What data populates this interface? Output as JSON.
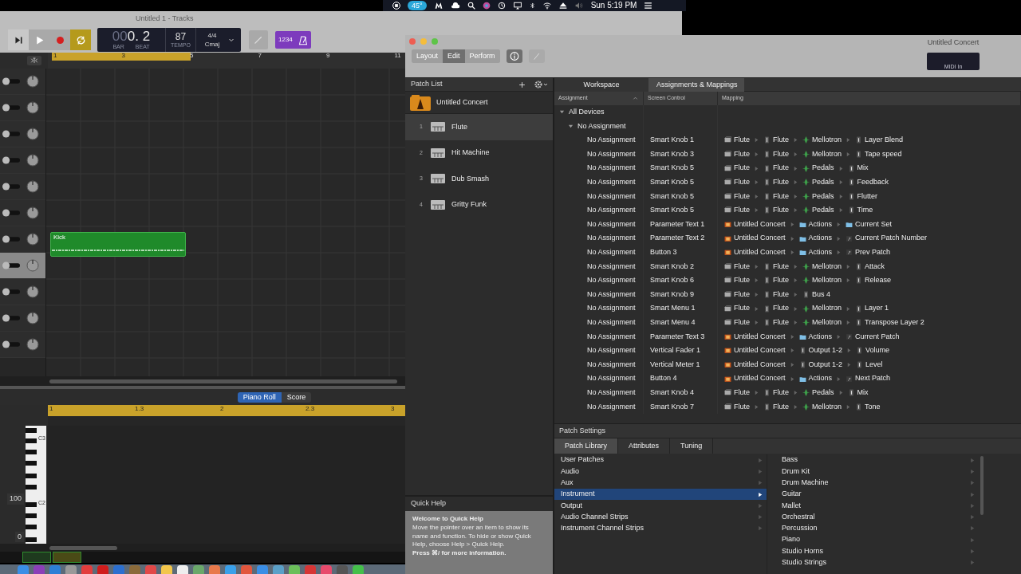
{
  "menu_bar": {
    "temperature": "45°",
    "clock": "Sun 5:19 PM"
  },
  "tracks_window": {
    "title": "Untitled 1 - Tracks",
    "transport": [
      {
        "kind": "forward",
        "on": false
      },
      {
        "kind": "play",
        "on": false
      },
      {
        "kind": "record",
        "on": false
      },
      {
        "kind": "cycle",
        "on": true
      }
    ],
    "lcd": {
      "bar_dim": "00",
      "position": "0. 2",
      "bar_label": "BAR",
      "beat_label": "BEAT",
      "tempo": "87",
      "tempo_label": "TEMPO",
      "signature": "4/4",
      "key": "Cmaj"
    },
    "count_in": "1234",
    "ruler": [
      "1",
      "3",
      "5",
      "7",
      "9",
      "11"
    ],
    "tracks": [
      {
        "selected": false
      },
      {
        "selected": false
      },
      {
        "selected": false
      },
      {
        "selected": false
      },
      {
        "selected": false
      },
      {
        "selected": false
      },
      {
        "selected": false
      },
      {
        "selected": true
      },
      {
        "selected": false
      },
      {
        "selected": false
      },
      {
        "selected": false
      }
    ],
    "region": {
      "name": "Kick"
    },
    "editor": {
      "tabs": [
        {
          "label": "Piano Roll",
          "selected": true
        },
        {
          "label": "Score",
          "selected": false
        }
      ],
      "ruler": [
        "1",
        "1.3",
        "2",
        "2.3",
        "3"
      ],
      "key_labels": [
        "C3",
        "C2"
      ],
      "values": [
        "100",
        "0"
      ]
    }
  },
  "mainstage": {
    "title": "Untitled Concert",
    "midi_display": "MIDI In",
    "modes": [
      {
        "label": "Layout",
        "selected": false
      },
      {
        "label": "Edit",
        "selected": true
      },
      {
        "label": "Perform",
        "selected": false
      }
    ],
    "patch_list": {
      "title": "Patch List",
      "concert": "Untitled Concert",
      "patches": [
        {
          "number": "1",
          "name": "Flute",
          "selected": true
        },
        {
          "number": "2",
          "name": "Hit Machine",
          "selected": false
        },
        {
          "number": "3",
          "name": "Dub Smash",
          "selected": false
        },
        {
          "number": "4",
          "name": "Gritty Funk",
          "selected": false
        }
      ]
    },
    "quick_help": {
      "title": "Quick Help",
      "heading": "Welcome to Quick Help",
      "body": "Move the pointer over an item to show its name and function. To hide or show Quick Help, choose Help > Quick Help.",
      "footer": "Press ⌘/ for more information."
    },
    "tabs": [
      {
        "label": "Workspace",
        "selected": false
      },
      {
        "label": "Assignments & Mappings",
        "selected": true
      }
    ],
    "columns": [
      "Assignment",
      "Screen Control",
      "Mapping"
    ],
    "device_tree": {
      "label": "All Devices",
      "expanded": true,
      "children": [
        {
          "label": "No Assignment",
          "expanded": true,
          "children": [
            {
              "assignment": "No Assignment",
              "screen_control": "Smart Knob 1",
              "mapping": [
                {
                  "kind": "patch",
                  "text": "Flute"
                },
                {
                  "kind": "strip",
                  "text": "Flute"
                },
                {
                  "kind": "plugin",
                  "text": "Mellotron"
                },
                {
                  "kind": "param",
                  "text": "Layer Blend"
                }
              ]
            },
            {
              "assignment": "No Assignment",
              "screen_control": "Smart Knob 3",
              "mapping": [
                {
                  "kind": "patch",
                  "text": "Flute"
                },
                {
                  "kind": "strip",
                  "text": "Flute"
                },
                {
                  "kind": "plugin",
                  "text": "Mellotron"
                },
                {
                  "kind": "param",
                  "text": "Tape speed"
                }
              ]
            },
            {
              "assignment": "No Assignment",
              "screen_control": "Smart Knob 5",
              "mapping": [
                {
                  "kind": "patch",
                  "text": "Flute"
                },
                {
                  "kind": "strip",
                  "text": "Flute"
                },
                {
                  "kind": "plugin",
                  "text": "Pedals"
                },
                {
                  "kind": "param",
                  "text": "Mix"
                }
              ]
            },
            {
              "assignment": "No Assignment",
              "screen_control": "Smart Knob 5",
              "mapping": [
                {
                  "kind": "patch",
                  "text": "Flute"
                },
                {
                  "kind": "strip",
                  "text": "Flute"
                },
                {
                  "kind": "plugin",
                  "text": "Pedals"
                },
                {
                  "kind": "param",
                  "text": "Feedback"
                }
              ]
            },
            {
              "assignment": "No Assignment",
              "screen_control": "Smart Knob 5",
              "mapping": [
                {
                  "kind": "patch",
                  "text": "Flute"
                },
                {
                  "kind": "strip",
                  "text": "Flute"
                },
                {
                  "kind": "plugin",
                  "text": "Pedals"
                },
                {
                  "kind": "param",
                  "text": "Flutter"
                }
              ]
            },
            {
              "assignment": "No Assignment",
              "screen_control": "Smart Knob 5",
              "mapping": [
                {
                  "kind": "patch",
                  "text": "Flute"
                },
                {
                  "kind": "strip",
                  "text": "Flute"
                },
                {
                  "kind": "plugin",
                  "text": "Pedals"
                },
                {
                  "kind": "param",
                  "text": "Time"
                }
              ]
            },
            {
              "assignment": "No Assignment",
              "screen_control": "Parameter Text 1",
              "mapping": [
                {
                  "kind": "concert",
                  "text": "Untitled Concert"
                },
                {
                  "kind": "folder",
                  "text": "Actions"
                },
                {
                  "kind": "folder",
                  "text": "Current Set"
                }
              ]
            },
            {
              "assignment": "No Assignment",
              "screen_control": "Parameter Text 2",
              "mapping": [
                {
                  "kind": "concert",
                  "text": "Untitled Concert"
                },
                {
                  "kind": "folder",
                  "text": "Actions"
                },
                {
                  "kind": "action",
                  "text": "Current Patch Number"
                }
              ]
            },
            {
              "assignment": "No Assignment",
              "screen_control": "Button 3",
              "mapping": [
                {
                  "kind": "concert",
                  "text": "Untitled Concert"
                },
                {
                  "kind": "folder",
                  "text": "Actions"
                },
                {
                  "kind": "action",
                  "text": "Prev Patch"
                }
              ]
            },
            {
              "assignment": "No Assignment",
              "screen_control": "Smart Knob 2",
              "mapping": [
                {
                  "kind": "patch",
                  "text": "Flute"
                },
                {
                  "kind": "strip",
                  "text": "Flute"
                },
                {
                  "kind": "plugin",
                  "text": "Mellotron"
                },
                {
                  "kind": "param",
                  "text": "Attack"
                }
              ]
            },
            {
              "assignment": "No Assignment",
              "screen_control": "Smart Knob 6",
              "mapping": [
                {
                  "kind": "patch",
                  "text": "Flute"
                },
                {
                  "kind": "strip",
                  "text": "Flute"
                },
                {
                  "kind": "plugin",
                  "text": "Mellotron"
                },
                {
                  "kind": "param",
                  "text": "Release"
                }
              ]
            },
            {
              "assignment": "No Assignment",
              "screen_control": "Smart Knob 9",
              "mapping": [
                {
                  "kind": "patch",
                  "text": "Flute"
                },
                {
                  "kind": "strip",
                  "text": "Flute"
                },
                {
                  "kind": "param",
                  "text": "Bus 4"
                }
              ]
            },
            {
              "assignment": "No Assignment",
              "screen_control": "Smart Menu 1",
              "mapping": [
                {
                  "kind": "patch",
                  "text": "Flute"
                },
                {
                  "kind": "strip",
                  "text": "Flute"
                },
                {
                  "kind": "plugin",
                  "text": "Mellotron"
                },
                {
                  "kind": "param",
                  "text": "Layer 1"
                }
              ]
            },
            {
              "assignment": "No Assignment",
              "screen_control": "Smart Menu 4",
              "mapping": [
                {
                  "kind": "patch",
                  "text": "Flute"
                },
                {
                  "kind": "strip",
                  "text": "Flute"
                },
                {
                  "kind": "plugin",
                  "text": "Mellotron"
                },
                {
                  "kind": "param",
                  "text": "Transpose Layer 2"
                }
              ]
            },
            {
              "assignment": "No Assignment",
              "screen_control": "Parameter Text 3",
              "mapping": [
                {
                  "kind": "concert",
                  "text": "Untitled Concert"
                },
                {
                  "kind": "folder",
                  "text": "Actions"
                },
                {
                  "kind": "action",
                  "text": "Current Patch"
                }
              ]
            },
            {
              "assignment": "No Assignment",
              "screen_control": "Vertical Fader 1",
              "mapping": [
                {
                  "kind": "concert",
                  "text": "Untitled Concert"
                },
                {
                  "kind": "param",
                  "text": "Output 1-2"
                },
                {
                  "kind": "param",
                  "text": "Volume"
                }
              ]
            },
            {
              "assignment": "No Assignment",
              "screen_control": "Vertical Meter 1",
              "mapping": [
                {
                  "kind": "concert",
                  "text": "Untitled Concert"
                },
                {
                  "kind": "param",
                  "text": "Output 1-2"
                },
                {
                  "kind": "param",
                  "text": "Level"
                }
              ]
            },
            {
              "assignment": "No Assignment",
              "screen_control": "Button 4",
              "mapping": [
                {
                  "kind": "concert",
                  "text": "Untitled Concert"
                },
                {
                  "kind": "folder",
                  "text": "Actions"
                },
                {
                  "kind": "action",
                  "text": "Next Patch"
                }
              ]
            },
            {
              "assignment": "No Assignment",
              "screen_control": "Smart Knob 4",
              "mapping": [
                {
                  "kind": "patch",
                  "text": "Flute"
                },
                {
                  "kind": "strip",
                  "text": "Flute"
                },
                {
                  "kind": "plugin",
                  "text": "Pedals"
                },
                {
                  "kind": "param",
                  "text": "Mix"
                }
              ]
            },
            {
              "assignment": "No Assignment",
              "screen_control": "Smart Knob 7",
              "mapping": [
                {
                  "kind": "patch",
                  "text": "Flute"
                },
                {
                  "kind": "strip",
                  "text": "Flute"
                },
                {
                  "kind": "plugin",
                  "text": "Mellotron"
                },
                {
                  "kind": "param",
                  "text": "Tone"
                }
              ]
            }
          ]
        }
      ]
    },
    "patch_settings": {
      "title": "Patch Settings",
      "tabs": [
        {
          "label": "Patch Library",
          "selected": true
        },
        {
          "label": "Attributes",
          "selected": false
        },
        {
          "label": "Tuning",
          "selected": false
        }
      ],
      "categories": [
        {
          "label": "User Patches",
          "selected": false
        },
        {
          "label": "Audio",
          "selected": false
        },
        {
          "label": "Aux",
          "selected": false
        },
        {
          "label": "Instrument",
          "selected": true
        },
        {
          "label": "Output",
          "selected": false
        },
        {
          "label": "Audio Channel Strips",
          "selected": false
        },
        {
          "label": "Instrument Channel Strips",
          "selected": false
        }
      ],
      "subcategories": [
        "Bass",
        "Drum Kit",
        "Drum Machine",
        "Guitar",
        "Mallet",
        "Orchestral",
        "Percussion",
        "Piano",
        "Studio Horns",
        "Studio Strings"
      ]
    }
  }
}
